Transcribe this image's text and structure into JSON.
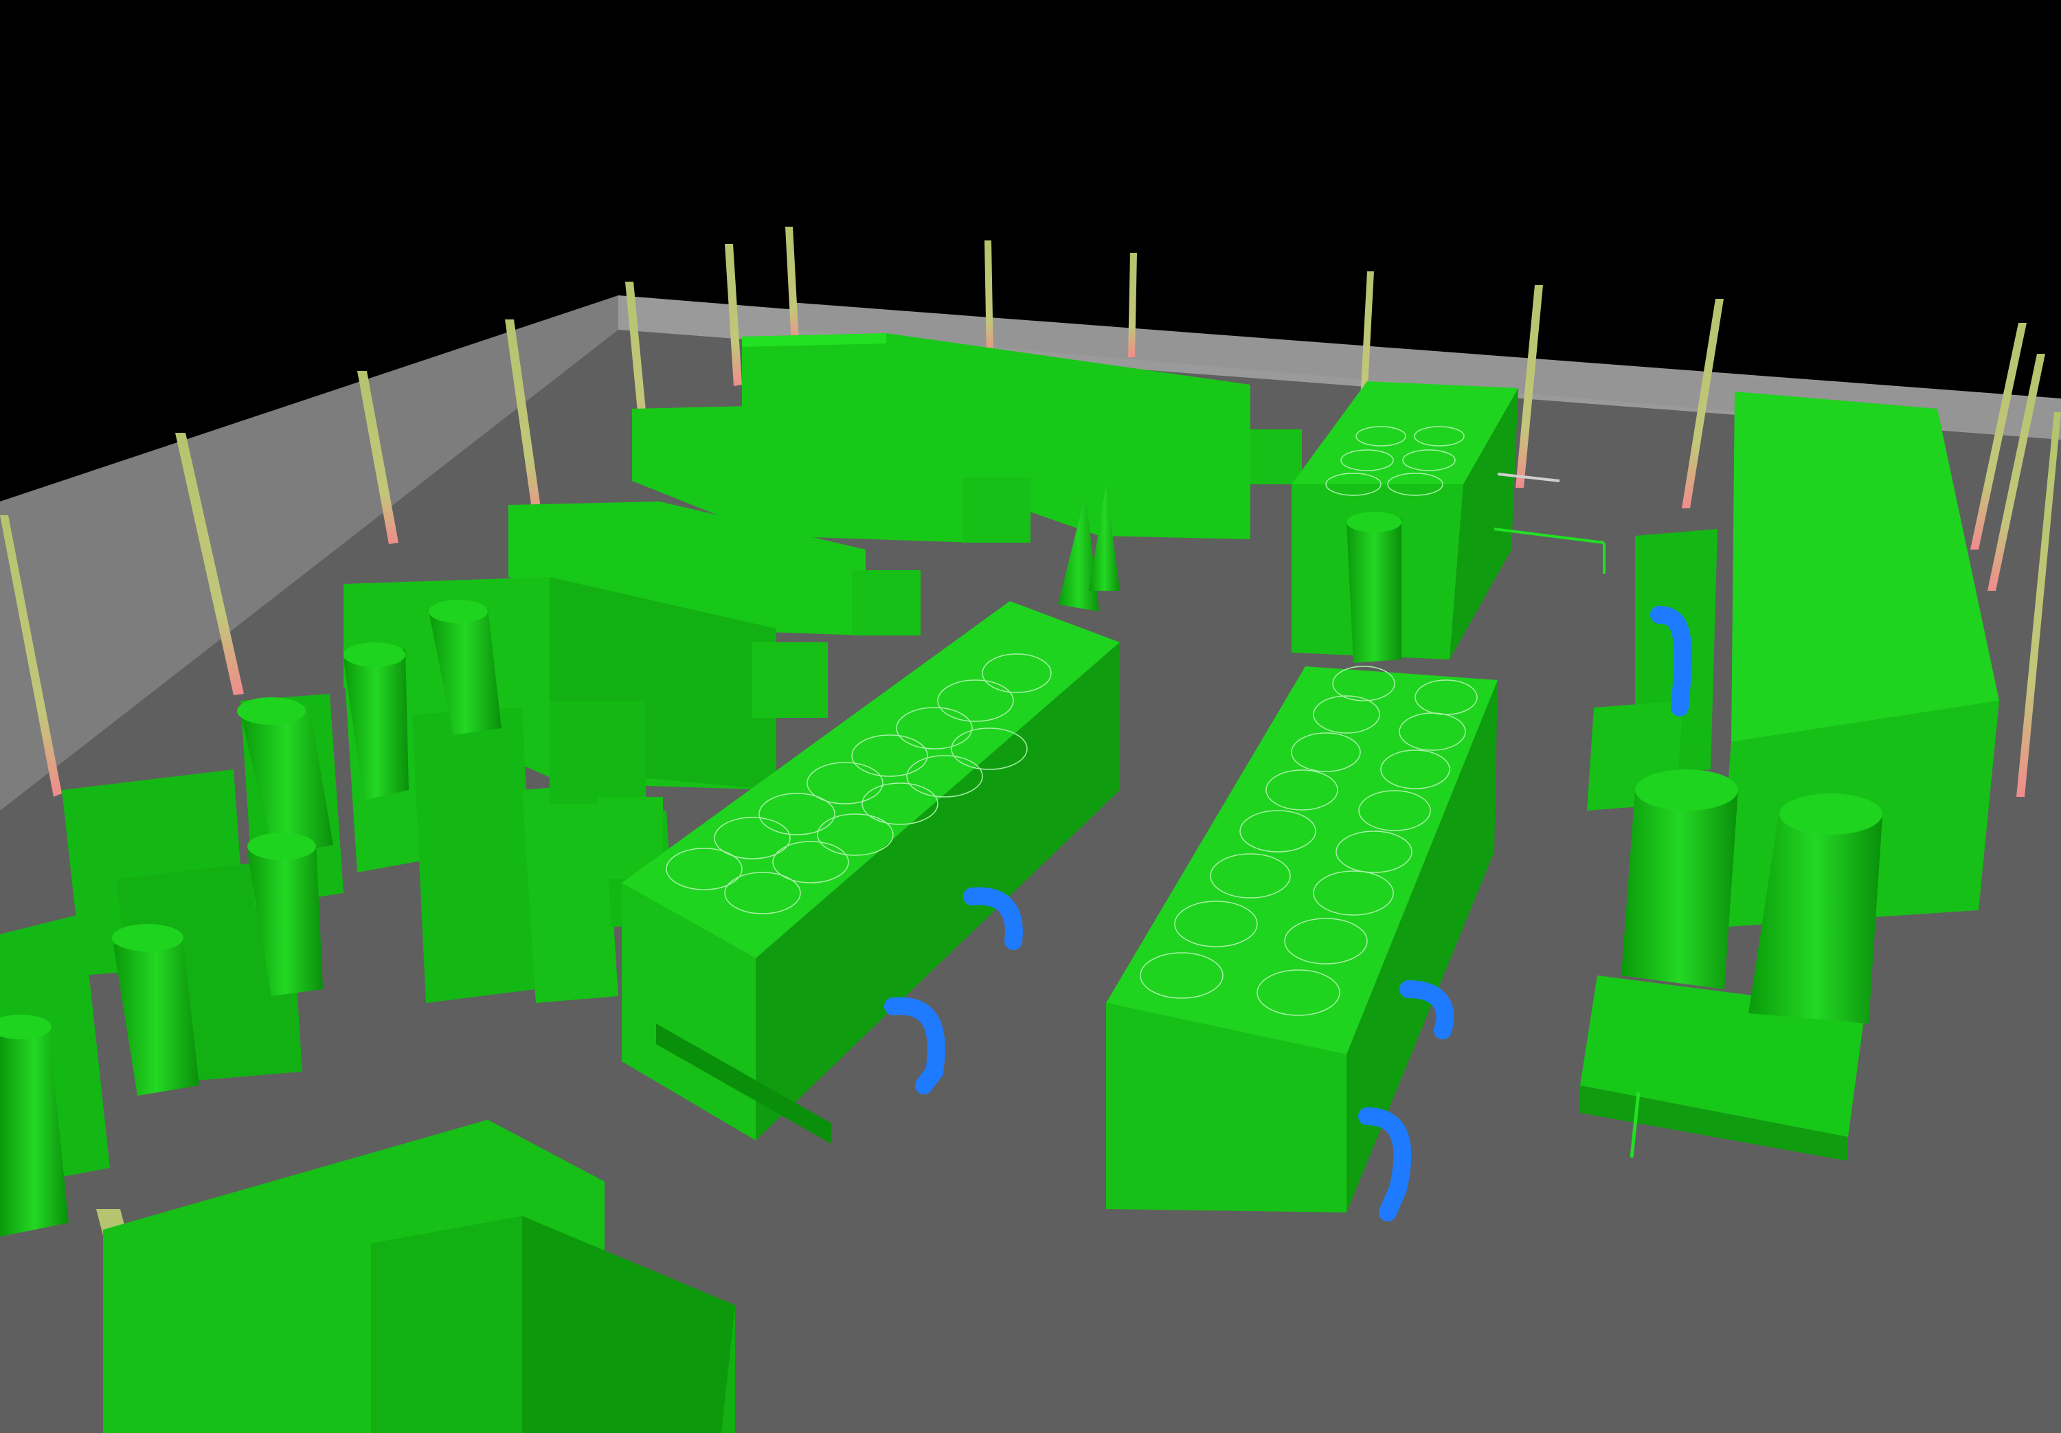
{
  "scene": {
    "view": "3d-perspective",
    "colors": {
      "background": "#000000",
      "floor": "#5f5f5f",
      "wall": "#8c8c8c",
      "equipment_light": "#22e022",
      "equipment_mid": "#16c016",
      "equipment_dark": "#0a8f0a",
      "pipe": "#1e7bff",
      "column": "#b5c46e",
      "column_accent": "#f08c8c"
    },
    "objects": [
      {
        "name": "radiator-cooler-1",
        "type": "radiator-fan-bank",
        "fan_count": 14
      },
      {
        "name": "radiator-cooler-2",
        "type": "radiator-fan-bank",
        "fan_count": 16
      },
      {
        "name": "radiator-cooler-3",
        "type": "radiator-fan-bank",
        "fan_count": 6
      },
      {
        "name": "genset-1",
        "type": "engine-enclosure"
      },
      {
        "name": "genset-2",
        "type": "engine-enclosure"
      },
      {
        "name": "genset-3",
        "type": "engine-enclosure"
      },
      {
        "name": "genset-4",
        "type": "engine-enclosure"
      },
      {
        "name": "genset-right",
        "type": "engine-enclosure"
      },
      {
        "name": "exhaust-stacks",
        "type": "exhaust-silencer"
      },
      {
        "name": "cooling-pipes",
        "type": "pipe",
        "color": "#1e7bff"
      },
      {
        "name": "structural-columns",
        "type": "column"
      }
    ]
  }
}
